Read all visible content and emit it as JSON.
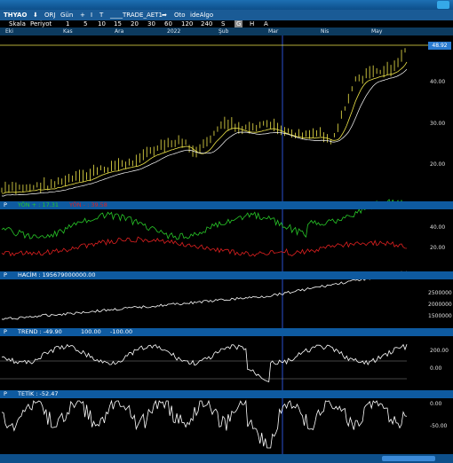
{
  "window": {
    "twitter_icon": "twitter-bird-icon"
  },
  "toolbar1": {
    "symbol": "THYAO",
    "orj": "ORJ",
    "gun": "Gün",
    "plus": "+",
    "cursor": "I",
    "t": "T",
    "trade": "____TRADE_AET1",
    "oto": "Oto",
    "idealgo": "ideAlgo"
  },
  "toolbar2": {
    "skala": "Skala",
    "periyot": "Periyot",
    "periods": [
      "1",
      "5",
      "10",
      "15",
      "20",
      "30",
      "60",
      "120",
      "240",
      "S",
      "G",
      "H",
      "A"
    ],
    "selected": "G"
  },
  "months": [
    "Eki",
    "Kas",
    "Ara",
    "2022",
    "Şub",
    "Mar",
    "Nis",
    "May"
  ],
  "price_panel": {
    "last_price": "48.92",
    "y_ticks": [
      "40.00",
      "30.00",
      "20.00"
    ]
  },
  "yon_panel": {
    "p": "P",
    "label_plus": "YÖN + : 17.31",
    "label_minus": "YÖN - : 39.58",
    "plus_color": "#28c828",
    "minus_color": "#e02020",
    "y_ticks": [
      "40.00",
      "20.00"
    ]
  },
  "hacim_panel": {
    "p": "P",
    "label": "HACİM : 195679000000.00",
    "y_ticks": [
      "2500000",
      "2000000",
      "1500000"
    ]
  },
  "trend_panel": {
    "p": "P",
    "label": "TREND : -49.90",
    "level1": "100.00",
    "level2": "-100.00",
    "y_ticks": [
      "200.00",
      "0.00"
    ]
  },
  "tetik_panel": {
    "p": "P",
    "label": "TETİK : -52.47",
    "y_ticks": [
      "0.00",
      "-50.00"
    ]
  },
  "colors": {
    "price_line": "#f0e64a",
    "cursor_line": "#2a4fd0",
    "panel_bar": "#0e5aa0"
  }
}
